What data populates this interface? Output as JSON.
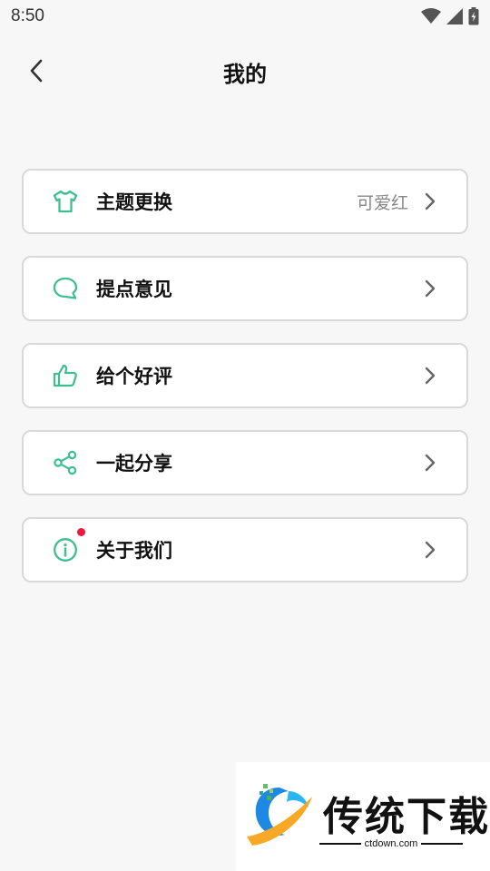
{
  "status_bar": {
    "time": "8:50"
  },
  "header": {
    "title": "我的"
  },
  "menu": [
    {
      "label": "主题更换",
      "value": "可爱红",
      "icon": "shirt-icon"
    },
    {
      "label": "提点意见",
      "value": "",
      "icon": "chat-bubble-icon"
    },
    {
      "label": "给个好评",
      "value": "",
      "icon": "thumbs-up-icon"
    },
    {
      "label": "一起分享",
      "value": "",
      "icon": "share-icon"
    },
    {
      "label": "关于我们",
      "value": "",
      "icon": "info-icon",
      "badge": "red-dot"
    }
  ],
  "watermark": {
    "brand": "传统下载",
    "url": "ctdown.com"
  },
  "colors": {
    "accent": "#3cc08e",
    "badge": "#f0193c",
    "background": "#f7f7f7",
    "border": "#d9d9d9"
  }
}
